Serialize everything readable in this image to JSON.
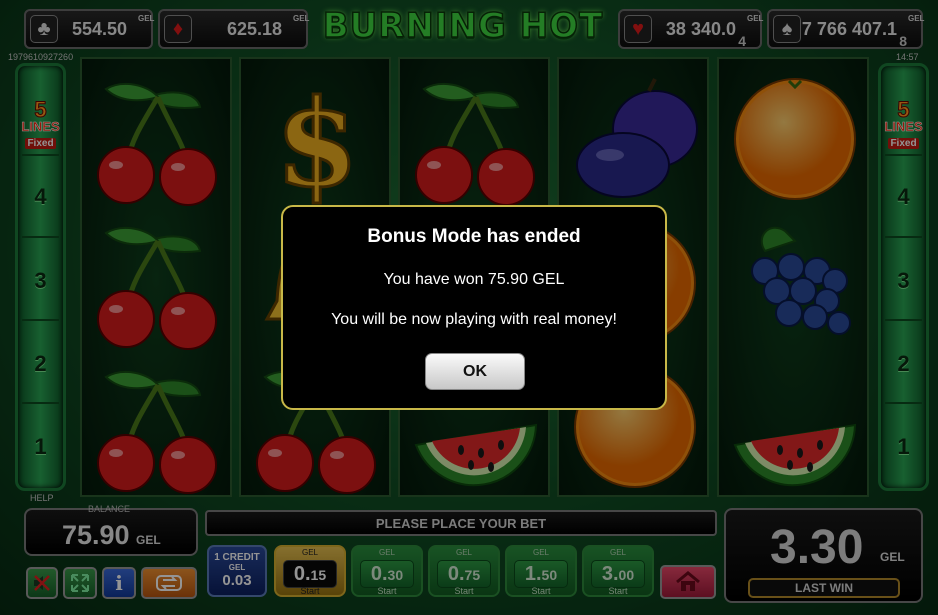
{
  "jackpots": [
    {
      "suit": "club",
      "value": "554.50",
      "currency": "GEL",
      "level": ""
    },
    {
      "suit": "diamond",
      "value": "625.18",
      "currency": "GEL",
      "level": ""
    },
    {
      "suit": "heart",
      "value": "38 340.0",
      "currency": "GEL",
      "level": "4"
    },
    {
      "suit": "spade",
      "value": "7 766 407.1",
      "currency": "GEL",
      "level": "8"
    }
  ],
  "title": "BURNING HOT",
  "session_id": "1979610927260",
  "clock": "14:57",
  "lines_panel": {
    "count": "5",
    "word": "LINES",
    "mode": "Fixed",
    "numbers": [
      "4",
      "3",
      "2",
      "1"
    ]
  },
  "reels": [
    [
      "cherry",
      "cherry",
      "cherry"
    ],
    [
      "dollar",
      "bell",
      "cherry"
    ],
    [
      "cherry",
      "orange",
      "watermelon"
    ],
    [
      "plum",
      "orange",
      "orange"
    ],
    [
      "orange",
      "grapes",
      "watermelon"
    ]
  ],
  "dialog": {
    "title": "Bonus Mode has ended",
    "line1": "You have won 75.90 GEL",
    "line2": "You will be now playing with real money!",
    "ok": "OK"
  },
  "help_label": "HELP",
  "balance": {
    "label": "BALANCE",
    "value": "75.90",
    "currency": "GEL"
  },
  "message": "PLEASE PLACE YOUR BET",
  "last_win": {
    "value": "3.30",
    "currency": "GEL",
    "label": "LAST WIN"
  },
  "credit": {
    "label": "1 CREDIT",
    "currency": "GEL",
    "value": "0.03"
  },
  "bets": [
    {
      "currency": "GEL",
      "int": "0.",
      "dec": "15",
      "start": "Start",
      "selected": true
    },
    {
      "currency": "GEL",
      "int": "0.",
      "dec": "30",
      "start": "Start",
      "selected": false
    },
    {
      "currency": "GEL",
      "int": "0.",
      "dec": "75",
      "start": "Start",
      "selected": false
    },
    {
      "currency": "GEL",
      "int": "1.",
      "dec": "50",
      "start": "Start",
      "selected": false
    },
    {
      "currency": "GEL",
      "int": "3.",
      "dec": "00",
      "start": "Start",
      "selected": false
    }
  ],
  "controls": {
    "info_label": "i"
  },
  "colors": {
    "accent_green": "#3fd840",
    "dialog_border": "#c8b848",
    "selected_bet": "#e6c050"
  }
}
